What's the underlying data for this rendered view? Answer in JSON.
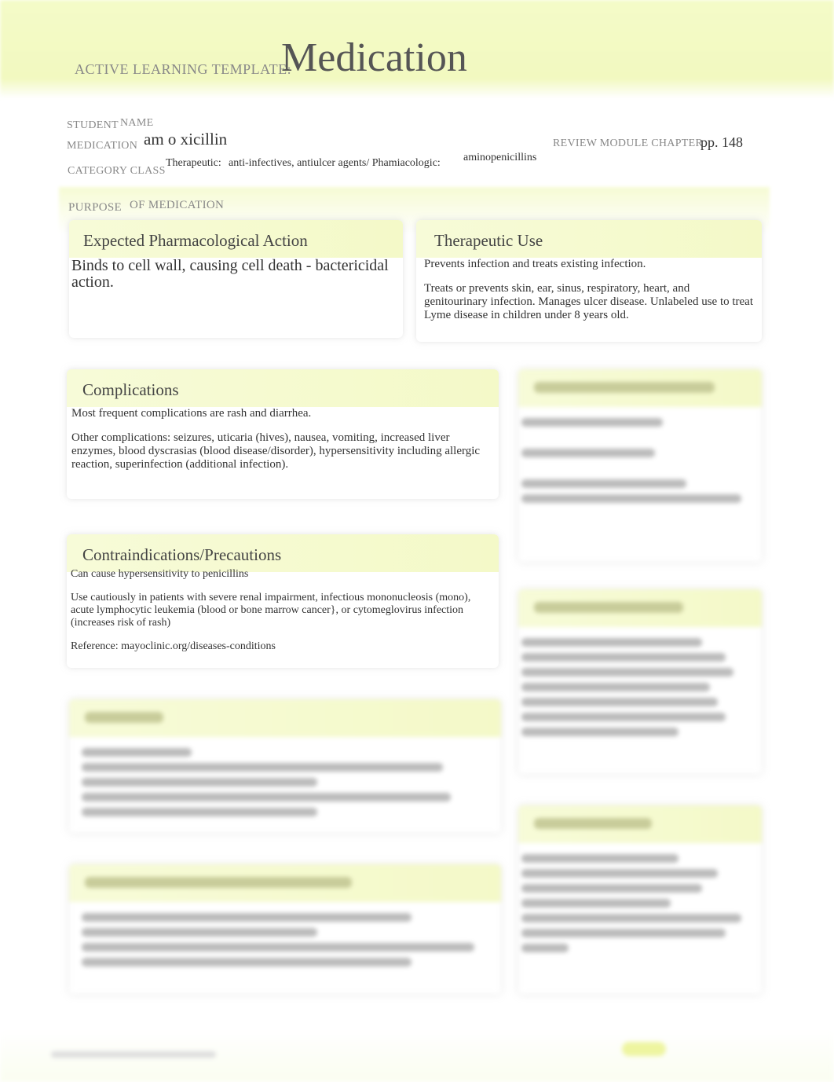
{
  "header": {
    "template_label": "ACTIVE LEARNING TEMPLATE:",
    "title": "Medication"
  },
  "fields": {
    "student_name_label_1": "STUDENT",
    "student_name_label_2": "NAME",
    "medication_label": "MEDICATION",
    "medication_value": "am o xicillin",
    "category_label": "CATEGORY CLASS",
    "therapeutic_label": "Therapeutic:",
    "therapeutic_value": "anti-infectives, antiulcer agents/ Phamiacologic:",
    "pharmacologic_value": "aminopenicillins",
    "review_label": "REVIEW MODULE CHAPTER",
    "review_value": "pp. 148",
    "purpose_label_1": "PURPOSE",
    "purpose_label_2": "OF MEDICATION"
  },
  "expected": {
    "title": "Expected Pharmacological Action",
    "text": "Binds to cell wall, causing cell death - bactericidal action."
  },
  "therapeutic": {
    "title": "Therapeutic Use",
    "p1": "Prevents infection and treats existing infection.",
    "p2": "Treats or prevents skin, ear, sinus, respiratory, heart, and genitourinary infection. Manages ulcer disease. Unlabeled use to treat Lyme disease in children under 8 years old."
  },
  "complications": {
    "title": "Complications",
    "p1": "Most frequent complications are rash and diarrhea.",
    "p2": "Other complications: seizures, uticaria (hives), nausea, vomiting, increased liver enzymes, blood dyscrasias (blood disease/disorder), hypersensitivity including allergic reaction, superinfection (additional infection)."
  },
  "contraindications": {
    "title": "Contraindications/Precautions",
    "p1": "Can cause hypersensitivity to penicillins",
    "p2": "Use cautiously in patients with severe renal impairment, infectious mononucleosis (mono), acute lymphocytic leukemia (blood or bone marrow cancer}, or cytomeglovirus infection (increases risk of rash)",
    "p3": "Reference: mayoclinic.org/diseases-conditions"
  }
}
